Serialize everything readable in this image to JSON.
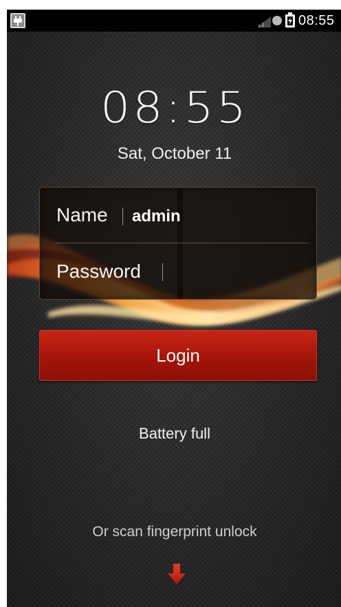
{
  "statusbar": {
    "time": "08:55",
    "icons": [
      "usb-icon",
      "signal-icon",
      "sync-icon",
      "battery-charging-icon"
    ]
  },
  "lockscreen": {
    "clock": "08:55",
    "date": "Sat, October 11"
  },
  "login": {
    "name_label": "Name",
    "name_value": "admin",
    "password_label": "Password",
    "password_value": "",
    "button_label": "Login"
  },
  "battery_status": "Battery full",
  "fingerprint_hint": "Or scan fingerprint unlock",
  "colors": {
    "accent": "#b51a0c",
    "statusbar": "#000000",
    "background": "#2b2b2b"
  }
}
